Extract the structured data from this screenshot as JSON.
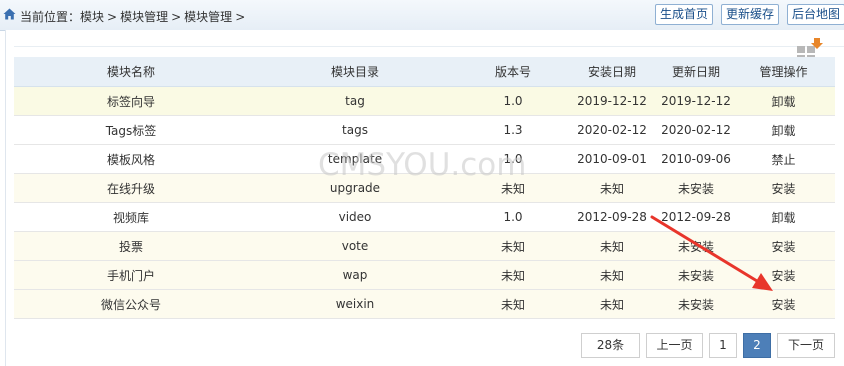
{
  "breadcrumb": {
    "prefix": "当前位置：",
    "items": [
      "模块",
      "模块管理",
      "模块管理"
    ],
    "separator": ">",
    "trailing": ">"
  },
  "top_buttons": [
    "生成首页",
    "更新缓存",
    "后台地图"
  ],
  "table": {
    "headers": [
      "模块名称",
      "模块目录",
      "版本号",
      "安装日期",
      "更新日期",
      "管理操作"
    ],
    "rows": [
      {
        "name": "标签向导",
        "dir": "tag",
        "version": "1.0",
        "install": "2019-12-12",
        "update": "2019-12-12",
        "action": "卸载",
        "status": "red"
      },
      {
        "name": "Tags标签",
        "dir": "tags",
        "version": "1.3",
        "install": "2020-02-12",
        "update": "2020-02-12",
        "action": "卸载",
        "status": "red"
      },
      {
        "name": "模板风格",
        "dir": "template",
        "version": "1.0",
        "install": "2010-09-01",
        "update": "2010-09-06",
        "action": "禁止",
        "status": "gray"
      },
      {
        "name": "在线升级",
        "dir": "upgrade",
        "version": "未知",
        "install": "未知",
        "update": "未安装",
        "action": "安装",
        "status": "green"
      },
      {
        "name": "视频库",
        "dir": "video",
        "version": "1.0",
        "install": "2012-09-28",
        "update": "2012-09-28",
        "action": "卸载",
        "status": "red"
      },
      {
        "name": "投票",
        "dir": "vote",
        "version": "未知",
        "install": "未知",
        "update": "未安装",
        "action": "安装",
        "status": "green"
      },
      {
        "name": "手机门户",
        "dir": "wap",
        "version": "未知",
        "install": "未知",
        "update": "未安装",
        "action": "安装",
        "status": "green"
      },
      {
        "name": "微信公众号",
        "dir": "weixin",
        "version": "未知",
        "install": "未知",
        "update": "未安装",
        "action": "安装",
        "status": "green"
      }
    ]
  },
  "watermark": "CMSYOU.com",
  "pagination": {
    "total": "28条",
    "prev": "上一页",
    "pages": [
      "1",
      "2"
    ],
    "current": "2",
    "next": "下一页"
  },
  "colors": {
    "accent": "#4d7fb8",
    "uninstall": "#cc0000",
    "install": "#1a9a1a",
    "disabled": "#999999",
    "arrow": "#e8352b"
  },
  "icons": [
    "home-icon",
    "module-tool-icon"
  ]
}
